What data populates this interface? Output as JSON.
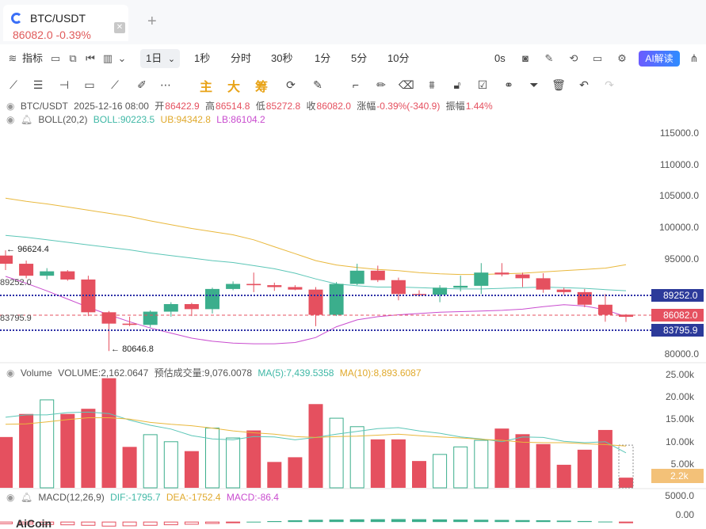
{
  "tab": {
    "title": "BTC/USDT",
    "price": "86082.0",
    "change": "-0.39%",
    "close_icon": "close-icon",
    "add_icon": "plus-icon"
  },
  "toolbar1": {
    "indicator_label": "指标",
    "periods": [
      "1日",
      "1秒",
      "分时",
      "30秒",
      "1分",
      "5分",
      "10分"
    ],
    "selected_period": "1日",
    "countdown": "0s",
    "ai_label": "AI解读"
  },
  "toolbar2": {
    "main_label": "主",
    "big_label": "大",
    "chip_label": "筹"
  },
  "ohlc": {
    "pair": "BTC/USDT",
    "datetime": "2025-12-16 08:00",
    "open_label": "开",
    "open": "86422.9",
    "high_label": "高",
    "high": "86514.8",
    "low_label": "低",
    "low": "85272.8",
    "close_label": "收",
    "close": "86082.0",
    "change_label": "涨幅",
    "change": "-0.39%(-340.9)",
    "amp_label": "振幅",
    "amp": "1.44%"
  },
  "boll": {
    "name": "BOLL(20,2)",
    "boll": "BOLL:90223.5",
    "ub": "UB:94342.8",
    "lb": "LB:86104.2"
  },
  "volume_info": {
    "name": "Volume",
    "volume": "VOLUME:2,162.0647",
    "estimate": "预估成交量:9,076.0078",
    "ma5": "MA(5):7,439.5358",
    "ma10": "MA(10):8,893.6087"
  },
  "macd_info": {
    "name": "MACD(12,26,9)",
    "dif": "DIF:-1795.7",
    "dea": "DEA:-1752.4",
    "macd": "MACD:-86.4"
  },
  "price_axis": [
    "115000.0",
    "110000.0",
    "105000.0",
    "100000.0",
    "95000.0",
    "80000.0"
  ],
  "price_tags": {
    "upper": "89252.0",
    "current": "86082.0",
    "lower": "83795.9"
  },
  "left_labels": {
    "high": "96624.4",
    "low": "80646.8",
    "upper": "89252.0",
    "lower": "83795.9"
  },
  "volume_axis": [
    "25.00k",
    "20.00k",
    "15.00k",
    "10.00k",
    "5.00k"
  ],
  "volume_tag": "2.2k",
  "macd_axis": [
    "5000.0",
    "0.00"
  ],
  "brand": "AiCoin",
  "colors": {
    "up": "#3bae8c",
    "down": "#e5505f",
    "ub": "#e9b83c",
    "mid": "#5cc6b7",
    "lb": "#c94ccf",
    "dotted": "#2c2fa6",
    "tag_bg": "#2c3a9a",
    "current_bg": "#e5505f",
    "vol_tag_bg": "#f3c178"
  },
  "chart_data": {
    "type": "candlestick",
    "candles": [
      {
        "o": 95800,
        "h": 96624,
        "l": 93500,
        "c": 94500
      },
      {
        "o": 94500,
        "h": 95000,
        "l": 92200,
        "c": 92600
      },
      {
        "o": 92600,
        "h": 93800,
        "l": 92000,
        "c": 93300
      },
      {
        "o": 93300,
        "h": 93500,
        "l": 91800,
        "c": 92000
      },
      {
        "o": 92000,
        "h": 92600,
        "l": 86200,
        "c": 86800
      },
      {
        "o": 86800,
        "h": 87000,
        "l": 80646,
        "c": 85000
      },
      {
        "o": 85000,
        "h": 86100,
        "l": 84600,
        "c": 84800
      },
      {
        "o": 84800,
        "h": 87100,
        "l": 84400,
        "c": 86900
      },
      {
        "o": 86900,
        "h": 88400,
        "l": 86100,
        "c": 88100
      },
      {
        "o": 88100,
        "h": 88300,
        "l": 86200,
        "c": 87300
      },
      {
        "o": 87300,
        "h": 90700,
        "l": 86600,
        "c": 90500
      },
      {
        "o": 90500,
        "h": 91700,
        "l": 90300,
        "c": 91300
      },
      {
        "o": 91300,
        "h": 93100,
        "l": 90000,
        "c": 91100
      },
      {
        "o": 91100,
        "h": 91500,
        "l": 90200,
        "c": 90800
      },
      {
        "o": 90800,
        "h": 91100,
        "l": 90300,
        "c": 90400
      },
      {
        "o": 90400,
        "h": 90800,
        "l": 84600,
        "c": 86400
      },
      {
        "o": 86400,
        "h": 91600,
        "l": 86200,
        "c": 91300
      },
      {
        "o": 91300,
        "h": 94500,
        "l": 91100,
        "c": 93400
      },
      {
        "o": 93400,
        "h": 94200,
        "l": 91600,
        "c": 91900
      },
      {
        "o": 91900,
        "h": 92300,
        "l": 88700,
        "c": 89700
      },
      {
        "o": 89700,
        "h": 90300,
        "l": 89300,
        "c": 89600
      },
      {
        "o": 89600,
        "h": 91100,
        "l": 88400,
        "c": 90700
      },
      {
        "o": 90700,
        "h": 92600,
        "l": 90100,
        "c": 91000
      },
      {
        "o": 91000,
        "h": 94600,
        "l": 89700,
        "c": 93100
      },
      {
        "o": 93100,
        "h": 94600,
        "l": 92500,
        "c": 92800
      },
      {
        "o": 92800,
        "h": 93100,
        "l": 90800,
        "c": 92200
      },
      {
        "o": 92200,
        "h": 93000,
        "l": 89900,
        "c": 90400
      },
      {
        "o": 90400,
        "h": 90700,
        "l": 89600,
        "c": 90000
      },
      {
        "o": 90000,
        "h": 90500,
        "l": 87600,
        "c": 88000
      },
      {
        "o": 88000,
        "h": 89700,
        "l": 85300,
        "c": 86400
      },
      {
        "o": 86423,
        "h": 86515,
        "l": 85273,
        "c": 86082
      }
    ],
    "ub": [
      104900,
      104400,
      104000,
      103500,
      103000,
      102500,
      102000,
      101300,
      100700,
      100100,
      99600,
      99100,
      98300,
      97200,
      96100,
      95000,
      94300,
      93900,
      93600,
      93400,
      93100,
      92900,
      92800,
      92800,
      92900,
      93000,
      93200,
      93400,
      93600,
      93800,
      94342
    ],
    "mid": [
      99000,
      98700,
      98300,
      97900,
      97500,
      97100,
      96700,
      96200,
      95800,
      95400,
      95000,
      94700,
      94200,
      93700,
      93000,
      92100,
      91300,
      91000,
      90800,
      90800,
      90700,
      90600,
      90500,
      90500,
      90600,
      90700,
      90800,
      90700,
      90600,
      90400,
      90223
    ],
    "lb": [
      92500,
      91400,
      90200,
      88900,
      87600,
      86400,
      85300,
      84300,
      83500,
      82700,
      82200,
      81900,
      81800,
      81800,
      82000,
      82800,
      84500,
      85600,
      86100,
      86400,
      86600,
      86800,
      86900,
      87000,
      87100,
      87300,
      87700,
      88000,
      87800,
      87200,
      86104
    ],
    "volume": [
      10800,
      15700,
      18700,
      15700,
      16800,
      23300,
      8700,
      11300,
      9800,
      7800,
      12700,
      10600,
      12200,
      5500,
      6500,
      17800,
      14800,
      13000,
      10300,
      10300,
      5700,
      7100,
      8700,
      10100,
      12600,
      11400,
      9300,
      4900,
      8100,
      12300,
      2162
    ],
    "vol_ma5": [
      15000,
      15500,
      15500,
      16000,
      16100,
      15800,
      14400,
      13300,
      12500,
      11100,
      10400,
      10200,
      10900,
      10800,
      10200,
      10700,
      11400,
      12000,
      12600,
      12800,
      12100,
      11600,
      10800,
      10400,
      9800,
      10800,
      10700,
      9900,
      9600,
      9800,
      7439
    ],
    "vol_ma10": [
      13500,
      13600,
      14000,
      14500,
      14900,
      14900,
      14600,
      13900,
      13500,
      13200,
      12700,
      12100,
      11700,
      11400,
      10900,
      10700,
      10900,
      11000,
      11200,
      11400,
      11100,
      10800,
      10600,
      10300,
      10100,
      9700,
      9600,
      9600,
      9400,
      9200,
      8893
    ],
    "macd_hist": [
      -300,
      -350,
      -420,
      -480,
      -560,
      -700,
      -650,
      -560,
      -470,
      -380,
      -250,
      -120,
      60,
      160,
      300,
      380,
      420,
      460,
      480,
      500,
      480,
      450,
      420,
      390,
      360,
      330,
      300,
      240,
      170,
      80,
      -86
    ],
    "ylim": [
      78800,
      117000
    ],
    "vol_ylim": [
      0,
      26600
    ],
    "macd_ylim": [
      -1200,
      5600
    ]
  }
}
